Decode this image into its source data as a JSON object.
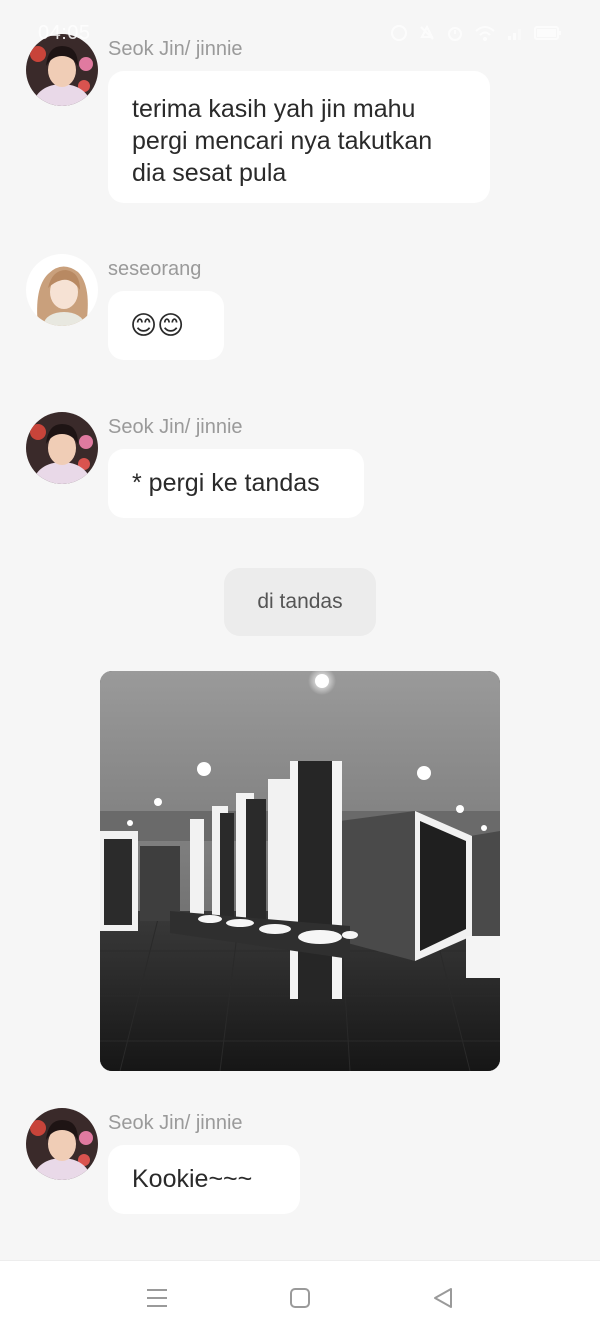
{
  "status_bar": {
    "time": "04:05",
    "icons": [
      "notification-icon",
      "mute-icon",
      "alarm-icon",
      "wifi-icon",
      "signal-icon",
      "battery-icon"
    ]
  },
  "messages": [
    {
      "sender": "Seok Jin/ jinnie",
      "avatar": "avatar-seokjin",
      "text_lines": [
        "terima kasih yah jin mahu",
        "pergi mencari nya takutkan",
        "dia sesat pula"
      ]
    },
    {
      "sender": "seseorang",
      "avatar": "avatar-seseorang",
      "text": "😊😊"
    },
    {
      "sender": "Seok Jin/ jinnie",
      "avatar": "avatar-seokjin",
      "text": "* pergi ke tandas"
    },
    {
      "sender": "Seok Jin/ jinnie",
      "avatar": "avatar-seokjin",
      "text": "Kookie~~~"
    }
  ],
  "narration": "di tandas",
  "image": {
    "subject": "restroom-interior-photo"
  },
  "nav_bar": {
    "buttons": [
      "menu-icon",
      "home-icon",
      "back-icon"
    ]
  },
  "colors": {
    "background": "#f6f6f6",
    "bubble": "#ffffff",
    "sender_text": "#9a9a9a",
    "narration_bg": "#ececec"
  }
}
